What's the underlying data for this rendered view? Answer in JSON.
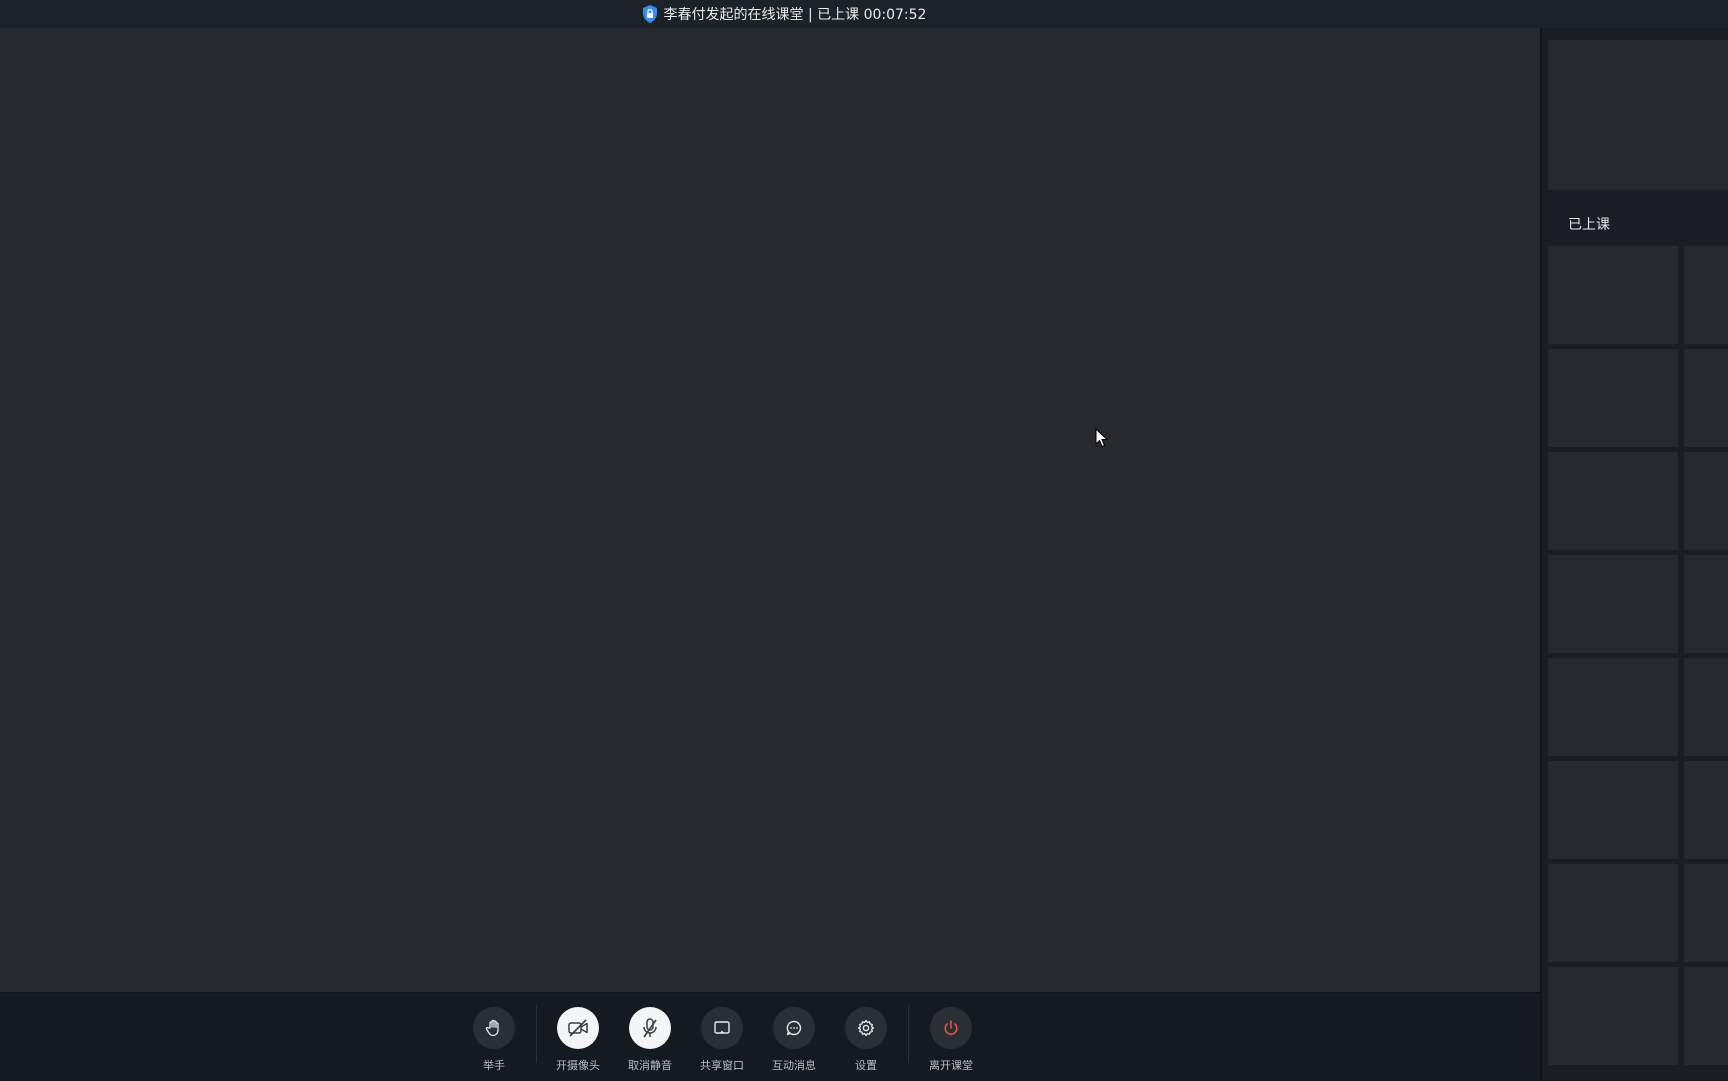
{
  "window": {
    "title": "李春付发起的在线课堂 | 已上课 00:07:52",
    "title_icon": "shield-lock-icon",
    "accent_color": "#3e8bf0"
  },
  "toolbar": {
    "items": [
      {
        "label": "举手",
        "icon": "hand-icon"
      },
      {
        "label": "开摄像头",
        "icon": "camera-off-icon"
      },
      {
        "label": "取消静音",
        "icon": "mic-off-icon"
      },
      {
        "label": "共享窗口",
        "icon": "screen-share-icon"
      },
      {
        "label": "互动消息",
        "icon": "chat-bubble-icon"
      },
      {
        "label": "设置",
        "icon": "gear-icon"
      },
      {
        "label": "离开课堂",
        "icon": "power-icon",
        "color": "#e0513f"
      }
    ]
  },
  "sidebar": {
    "section_label": "已上课"
  }
}
